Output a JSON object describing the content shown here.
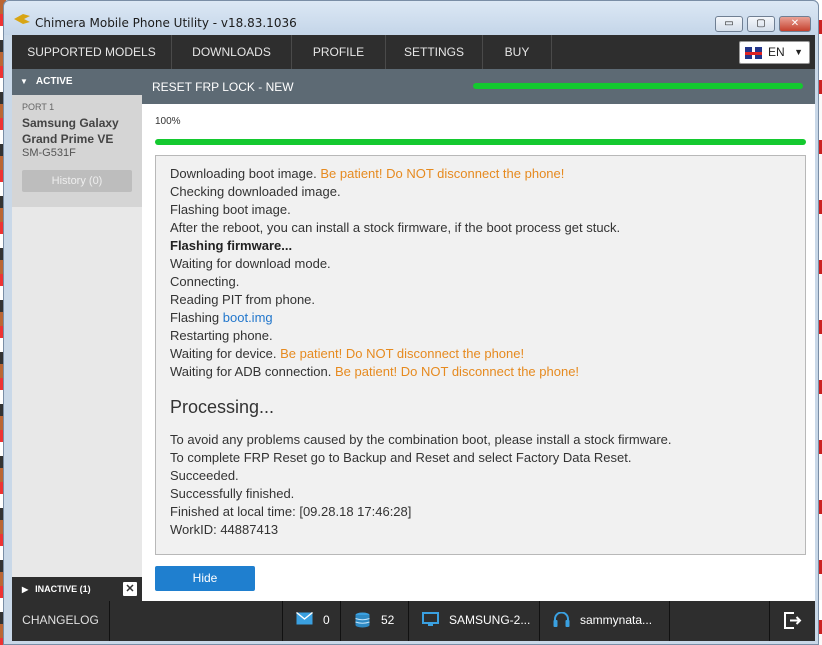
{
  "window": {
    "title": "Chimera Mobile Phone Utility - v18.83.1036",
    "min": "▭",
    "restore": "▢",
    "close": "✕"
  },
  "nav": {
    "items": [
      "SUPPORTED MODELS",
      "DOWNLOADS",
      "PROFILE",
      "SETTINGS",
      "BUY"
    ],
    "language": "EN"
  },
  "sidebar": {
    "active_label": "ACTIVE",
    "port_label": "PORT 1",
    "device_line1": "Samsung Galaxy",
    "device_line2": "Grand Prime VE",
    "model": "SM-G531F",
    "history_button": "History (0)",
    "inactive_label": "INACTIVE (1)",
    "inactive_close": "✕"
  },
  "main": {
    "title": "RESET FRP LOCK - NEW",
    "progress_label": "100%",
    "progress": 1.0,
    "hide_button": "Hide"
  },
  "log": {
    "l1": "Downloading boot image.",
    "l1w": "Be patient! Do NOT disconnect the phone!",
    "l2": "Checking downloaded image.",
    "l3": "Flashing boot image.",
    "l4": "After the reboot, you can install a stock firmware, if the boot process get stuck.",
    "l5": "Flashing firmware...",
    "l6": "Waiting for download mode.",
    "l7": "Connecting.",
    "l8": "Reading PIT from phone.",
    "l9": "Flashing",
    "l9link": "boot.img",
    "l10": "Restarting phone.",
    "l11": "Waiting for device.",
    "l11w": "Be patient! Do NOT disconnect the phone!",
    "l12": "Waiting for ADB connection.",
    "l12w": "Be patient! Do NOT disconnect the phone!",
    "processing": "Processing...",
    "p1": "To avoid any problems caused by the combination boot, please install a stock firmware.",
    "p2": "To complete FRP Reset go to Backup and Reset and select Factory Data Reset.",
    "p3": "Succeeded.",
    "p4": "Successfully finished.",
    "p5": "Finished at local time: [09.28.18 17:46:28]",
    "p6": "WorkID: 44887413"
  },
  "status": {
    "changelog": "CHANGELOG",
    "messages": "0",
    "credits": "52",
    "device": "SAMSUNG-2...",
    "user": "sammynata..."
  },
  "colors": {
    "accent_green": "#14c92f",
    "warn_orange": "#e68a1f",
    "link_blue": "#2277cc",
    "button_blue": "#1f7fcf"
  }
}
